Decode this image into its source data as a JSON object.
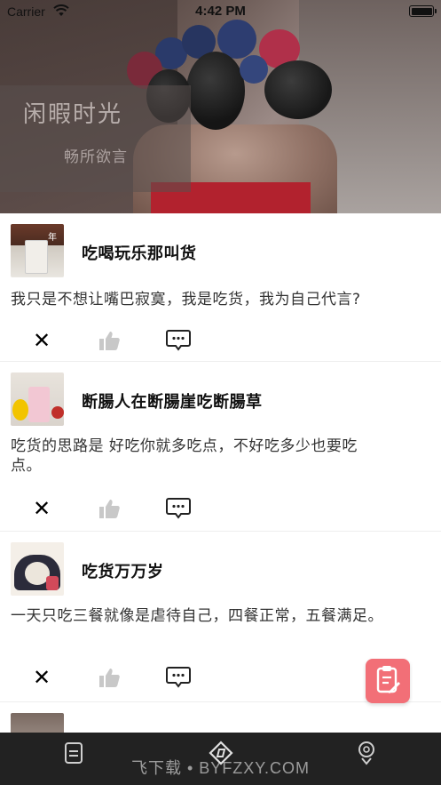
{
  "status_bar": {
    "carrier": "Carrier",
    "time": "4:42 PM"
  },
  "hero": {
    "title": "闲暇时光",
    "subtitle": "畅所欲言"
  },
  "posts": [
    {
      "title": "吃喝玩乐那叫货",
      "body": "我只是不想让嘴巴寂寞，我是吃货，我为自己代言?",
      "thumb": "drink-photo"
    },
    {
      "title": "断腸人在断腸崖吃断腸草",
      "body": "吃货的思路是 好吃你就多吃点，不好吃多少也要吃点。",
      "thumb": "smoothie-photo"
    },
    {
      "title": "吃货万万岁",
      "body": "一天只吃三餐就像是虐待自己，四餐正常，五餐满足。",
      "thumb": "bunny-photo"
    },
    {
      "title": "",
      "body": "",
      "thumb": "partial-photo"
    }
  ],
  "icons": {
    "close": "close-icon",
    "like": "thumbs-up-icon",
    "comment": "comment-icon",
    "fab": "clipboard-edit-icon",
    "tab_home": "document-icon",
    "tab_discover": "compass-icon",
    "tab_profile": "profile-icon"
  },
  "colors": {
    "fab": "#f26f77",
    "tabbar": "#222222",
    "like_icon": "#c8c8c8"
  },
  "watermark": "飞下载 • BYFZXY.COM"
}
